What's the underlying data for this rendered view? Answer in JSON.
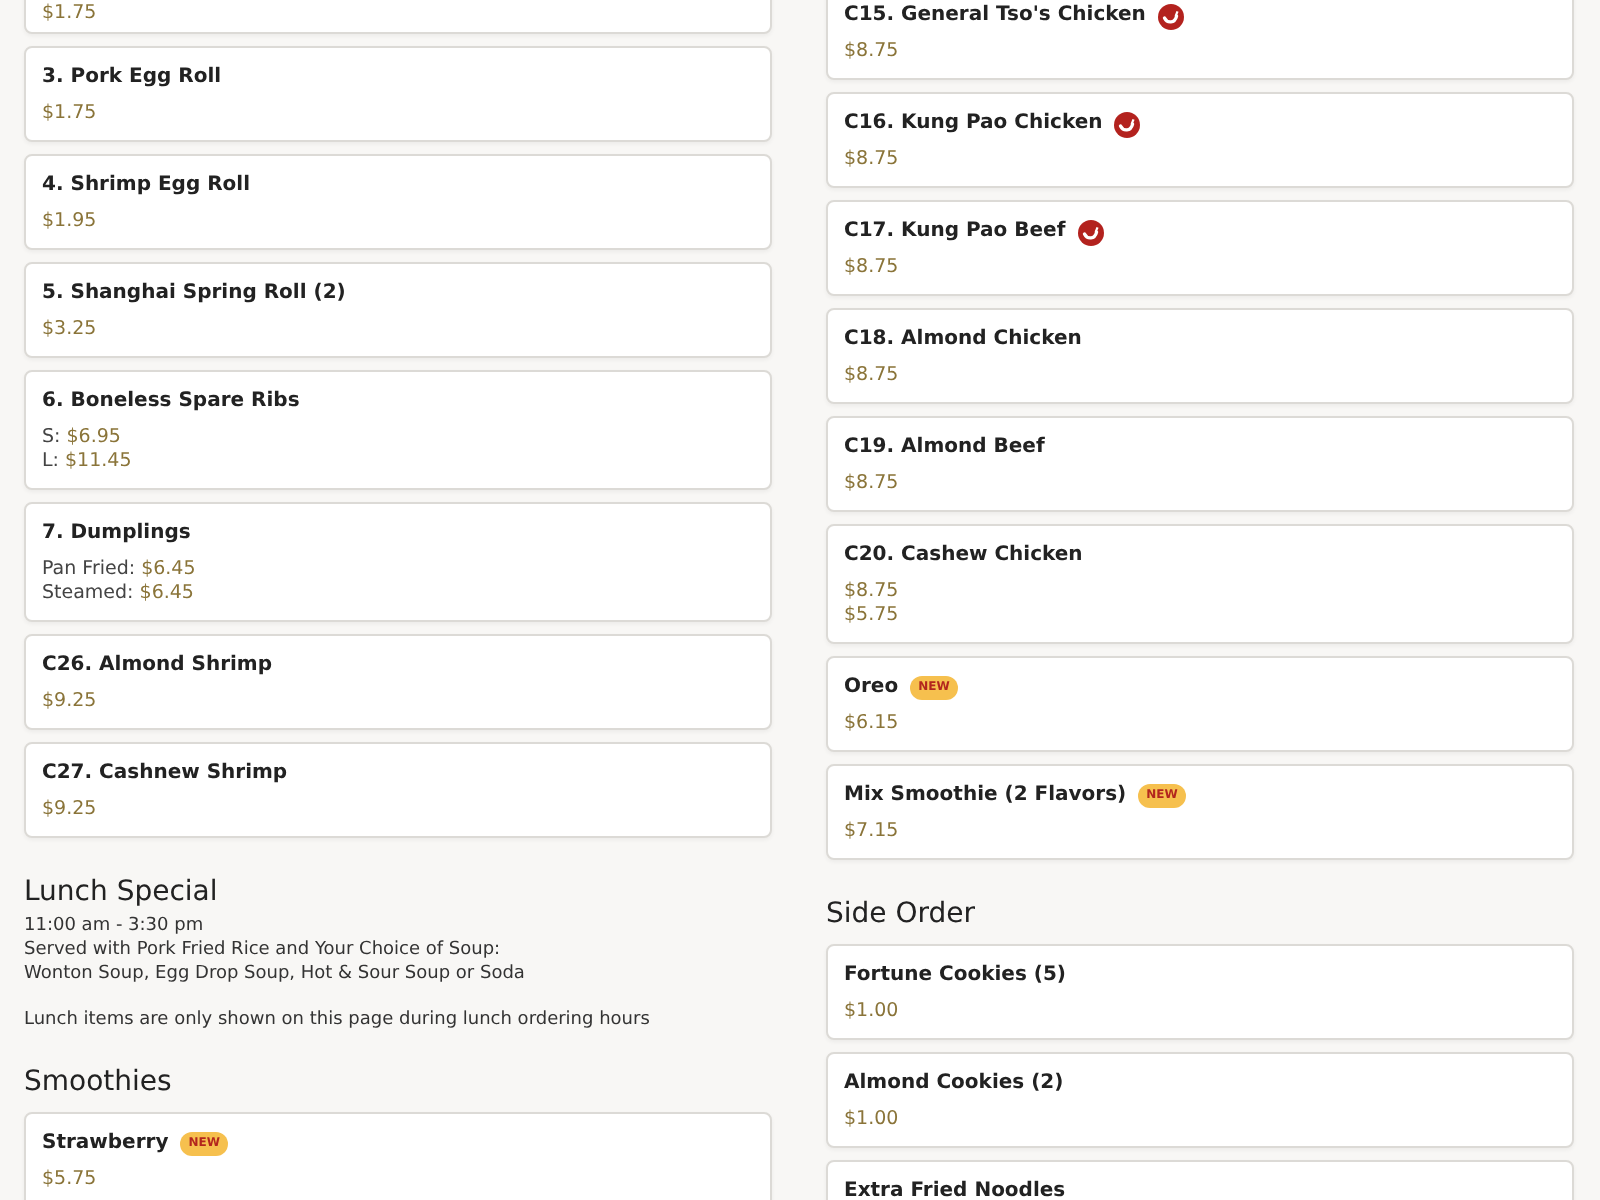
{
  "columns": [
    {
      "blocks": [
        {
          "kind": "card",
          "spicy": false,
          "prices": [
            {
              "amount": "$1.75"
            }
          ]
        },
        {
          "kind": "card",
          "title": "3. Pork Egg Roll",
          "spicy": false,
          "prices": [
            {
              "amount": "$1.75"
            }
          ]
        },
        {
          "kind": "card",
          "title": "4. Shrimp Egg Roll",
          "spicy": false,
          "prices": [
            {
              "amount": "$1.95"
            }
          ]
        },
        {
          "kind": "card",
          "title": "5. Shanghai Spring Roll (2)",
          "spicy": false,
          "prices": [
            {
              "amount": "$3.25"
            }
          ]
        },
        {
          "kind": "card",
          "title": "6. Boneless Spare Ribs",
          "spicy": false,
          "prices": [
            {
              "label": "S:",
              "amount": "$6.95"
            },
            {
              "label": "L:",
              "amount": "$11.45"
            }
          ]
        },
        {
          "kind": "card",
          "title": "7. Dumplings",
          "spicy": false,
          "prices": [
            {
              "label": "Pan Fried:",
              "amount": "$6.45"
            },
            {
              "label": "Steamed:",
              "amount": "$6.45"
            }
          ]
        },
        {
          "kind": "card",
          "title": "C26. Almond Shrimp",
          "spicy": false,
          "prices": [
            {
              "amount": "$9.25"
            }
          ]
        },
        {
          "kind": "card",
          "title": "C27. Cashnew Shrimp",
          "spicy": false,
          "prices": [
            {
              "amount": "$9.25"
            }
          ]
        },
        {
          "kind": "heading",
          "title": "Lunch Special",
          "paragraphs": [
            [
              "11:00 am - 3:30 pm",
              "Served with Pork Fried Rice and Your Choice of Soup:",
              "Wonton Soup, Egg Drop Soup, Hot & Sour Soup or Soda"
            ],
            [
              "Lunch items are only shown on this page during lunch ordering hours"
            ]
          ]
        },
        {
          "kind": "heading",
          "title": "Smoothies"
        },
        {
          "kind": "card",
          "title": "Strawberry",
          "badge": "NEW",
          "spicy": false,
          "prices": [
            {
              "amount": "$5.75"
            }
          ]
        }
      ]
    },
    {
      "blocks": [
        {
          "kind": "card",
          "title": "C15. General Tso's Chicken",
          "spicy": true,
          "prices": [
            {
              "amount": "$8.75"
            }
          ]
        },
        {
          "kind": "card",
          "title": "C16. Kung Pao Chicken",
          "spicy": true,
          "prices": [
            {
              "amount": "$8.75"
            }
          ]
        },
        {
          "kind": "card",
          "title": "C17. Kung Pao Beef",
          "spicy": true,
          "prices": [
            {
              "amount": "$8.75"
            }
          ]
        },
        {
          "kind": "card",
          "title": "C18. Almond Chicken",
          "spicy": false,
          "prices": [
            {
              "amount": "$8.75"
            }
          ]
        },
        {
          "kind": "card",
          "title": "C19. Almond Beef",
          "spicy": false,
          "prices": [
            {
              "amount": "$8.75"
            }
          ]
        },
        {
          "kind": "card",
          "title": "C20. Cashew Chicken",
          "spicy": false,
          "prices": [
            {
              "amount": "$8.75"
            },
            {
              "amount": "$5.75"
            }
          ]
        },
        {
          "kind": "card",
          "title": "Oreo",
          "badge": "NEW",
          "spicy": false,
          "prices": [
            {
              "amount": "$6.15"
            }
          ]
        },
        {
          "kind": "card",
          "title": "Mix Smoothie (2 Flavors)",
          "badge": "NEW",
          "spicy": false,
          "prices": [
            {
              "amount": "$7.15"
            }
          ]
        },
        {
          "kind": "heading",
          "title": "Side Order"
        },
        {
          "kind": "card",
          "title": "Fortune Cookies (5)",
          "spicy": false,
          "prices": [
            {
              "amount": "$1.00"
            }
          ]
        },
        {
          "kind": "card",
          "title": "Almond Cookies (2)",
          "spicy": false,
          "prices": [
            {
              "amount": "$1.00"
            }
          ]
        },
        {
          "kind": "card",
          "title": "Extra Fried Noodles",
          "spicy": false
        }
      ]
    }
  ]
}
